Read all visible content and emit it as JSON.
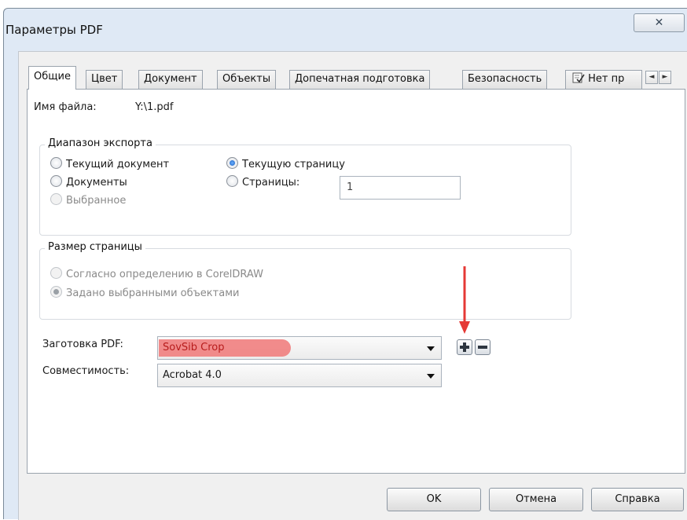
{
  "window": {
    "title": "Параметры PDF",
    "close_glyph": "✕"
  },
  "tabs": [
    {
      "label": "Общие",
      "active": true
    },
    {
      "label": "Цвет"
    },
    {
      "label": "Документ"
    },
    {
      "label": "Объекты"
    },
    {
      "label": "Допечатная подготовка"
    },
    {
      "label": "Безопасность"
    },
    {
      "label": "Нет пр",
      "icon": "checklist-icon"
    }
  ],
  "tab_scroll": {
    "left": "◄",
    "right": "►"
  },
  "file": {
    "label": "Имя файла:",
    "value": "Y:\\1.pdf"
  },
  "export_range": {
    "legend": "Диапазон экспорта",
    "options": {
      "current_document": {
        "label": "Текущий документ",
        "checked": false
      },
      "documents": {
        "label": "Документы",
        "checked": false
      },
      "selection": {
        "label": "Выбранное",
        "checked": false,
        "disabled": true
      },
      "current_page": {
        "label": "Текущую страницу",
        "checked": true
      },
      "pages": {
        "label": "Страницы:",
        "checked": false
      }
    },
    "pages_value": "1"
  },
  "page_size": {
    "legend": "Размер страницы",
    "options": {
      "as_defined": {
        "label": "Согласно определению в CorelDRAW",
        "checked": false,
        "disabled": true
      },
      "from_selected": {
        "label": "Задано выбранными объектами",
        "checked": true,
        "disabled": true
      }
    }
  },
  "preset": {
    "label": "Заготовка PDF:",
    "value": "SovSib Crop",
    "highlight_color": "#f07878"
  },
  "compat": {
    "label": "Совместимость:",
    "value": "Acrobat 4.0"
  },
  "annotation": {
    "arrow_color": "#e53935"
  },
  "footer": {
    "ok": "OK",
    "cancel": "Отмена",
    "help": "Справка"
  }
}
